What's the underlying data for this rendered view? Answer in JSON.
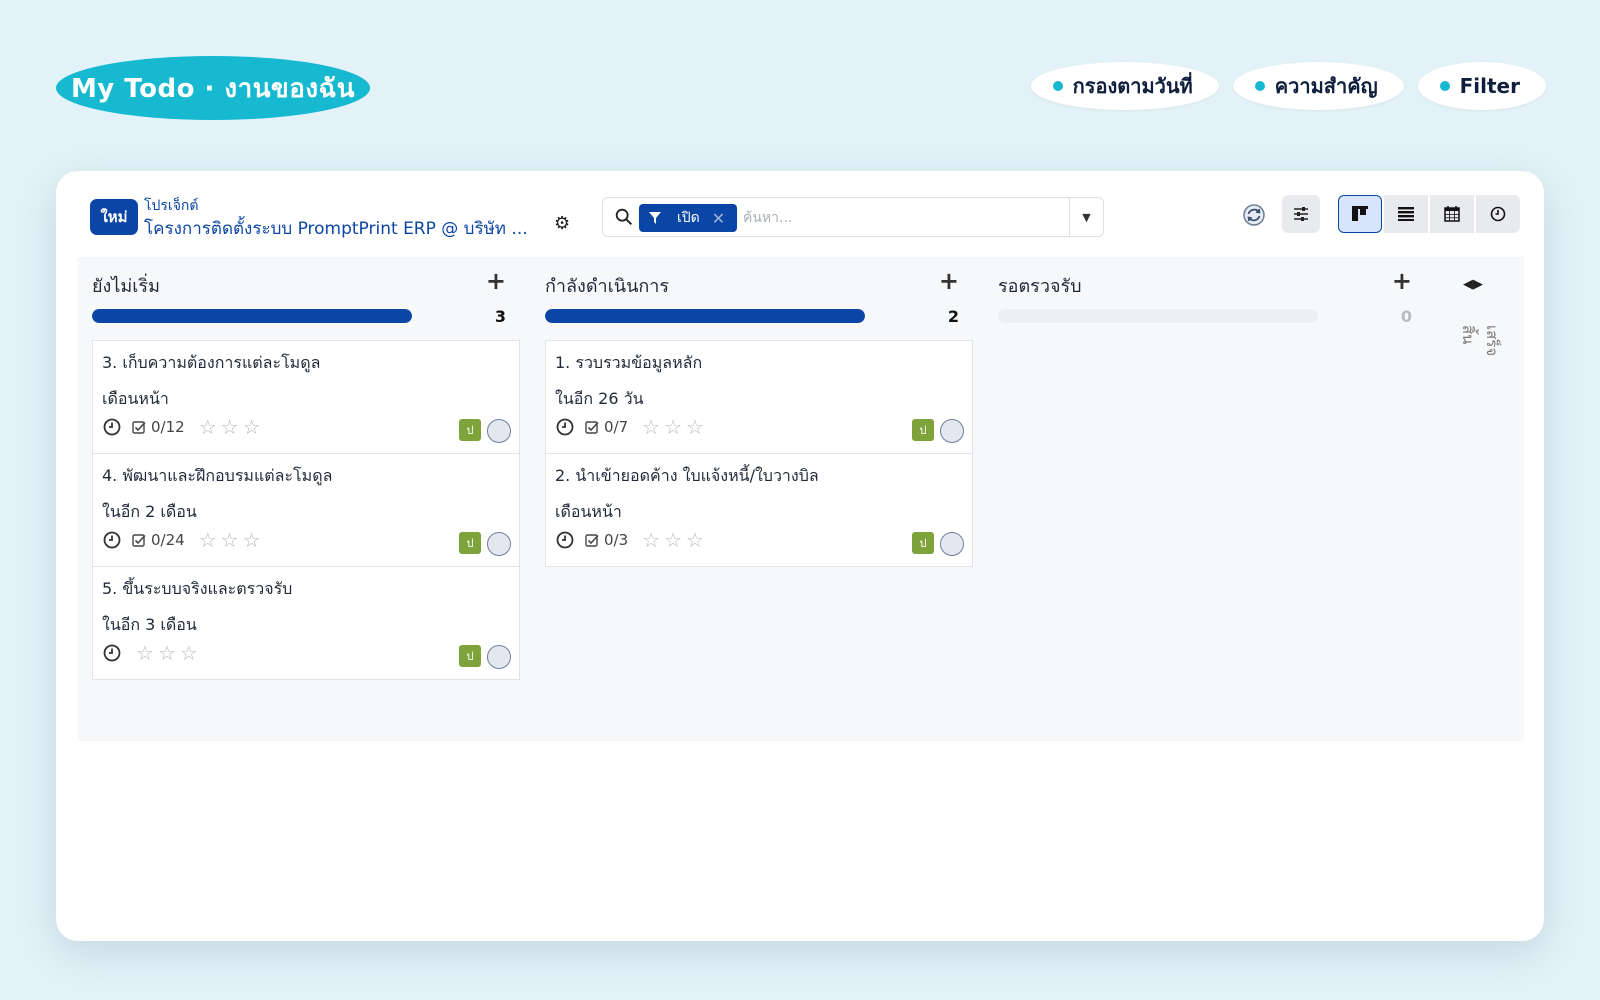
{
  "header": {
    "title": "My Todo · งานของฉัน",
    "filters": [
      {
        "label": "กรองตามวันที่"
      },
      {
        "label": "ความสำคัญ"
      },
      {
        "label": "Filter"
      }
    ]
  },
  "toolbar": {
    "new_label": "ใหม่",
    "breadcrumb_parent": "โปรเจ็กต์",
    "breadcrumb_current": "โครงการติดตั้งระบบ PromptPrint ERP @ บริษัท ...",
    "facet_label": "เปิด",
    "search_placeholder": "ค้นหา..."
  },
  "colors": {
    "accent": "#17b9d0",
    "primary": "#0b46a6",
    "tag": "#7ea33a"
  },
  "columns": [
    {
      "title": "ยังไม่เริ่ม",
      "count": "3",
      "progress": 1.0,
      "tasks": [
        {
          "title": "3. เก็บความต้องการแต่ละโมดูล",
          "date": "เดือนหน้า",
          "checklist": "0/12",
          "tag": "ป"
        },
        {
          "title": "4. พัฒนาและฝึกอบรมแต่ละโมดูล",
          "date": "ในอีก 2 เดือน",
          "checklist": "0/24",
          "tag": "ป"
        },
        {
          "title": "5. ขึ้นระบบจริงและตรวจรับ",
          "date": "ในอีก 3 เดือน",
          "checklist": "",
          "tag": "ป"
        }
      ]
    },
    {
      "title": "กำลังดำเนินการ",
      "count": "2",
      "progress": 1.0,
      "tasks": [
        {
          "title": "1. รวบรวมข้อมูลหลัก",
          "date": "ในอีก 26 วัน",
          "checklist": "0/7",
          "tag": "ป"
        },
        {
          "title": "2. นำเข้ายอดค้าง ใบแจ้งหนี้/ใบวางบิล",
          "date": "เดือนหน้า",
          "checklist": "0/3",
          "tag": "ป"
        }
      ]
    },
    {
      "title": "รอตรวจรับ",
      "count": "0",
      "progress": 0,
      "tasks": []
    }
  ],
  "folded_column": {
    "label": "เสร็จสิ้น"
  }
}
